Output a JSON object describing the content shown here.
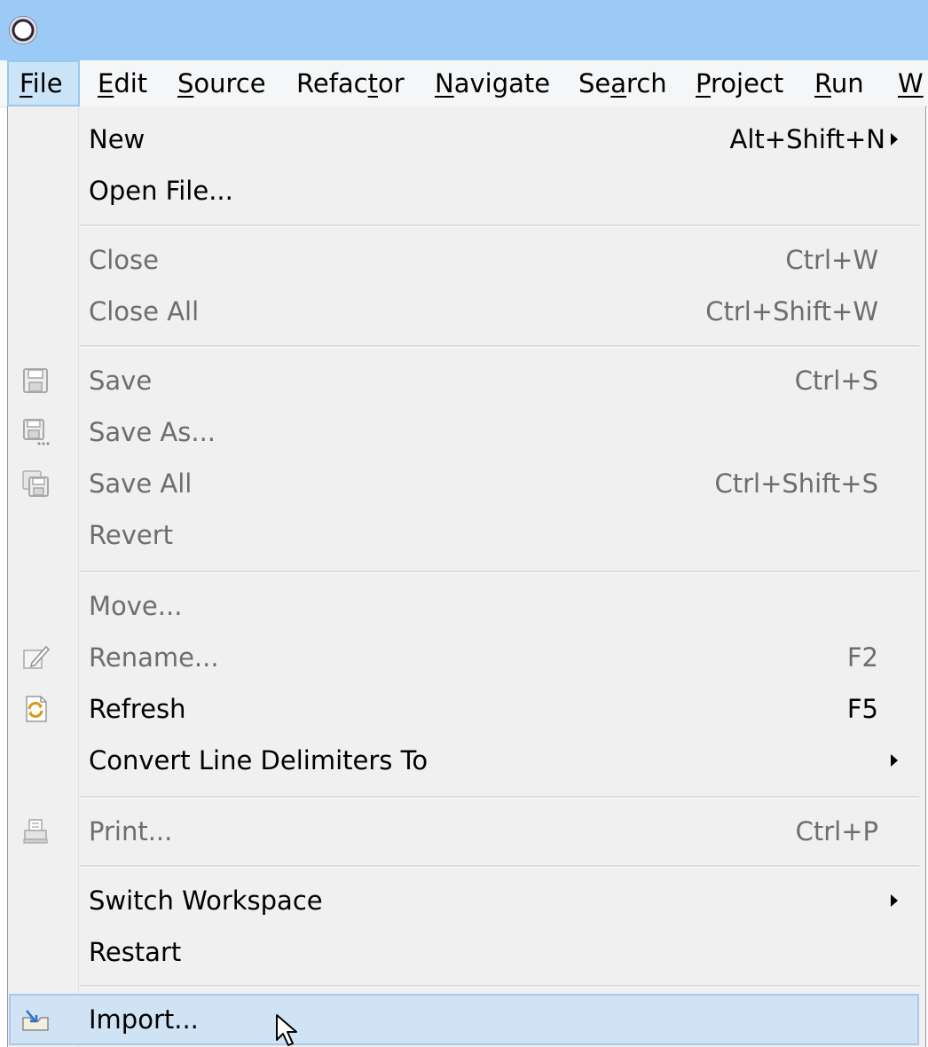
{
  "menubar": {
    "items": [
      {
        "prefix": "",
        "mnemonic": "F",
        "rest": "ile"
      },
      {
        "prefix": "",
        "mnemonic": "E",
        "rest": "dit"
      },
      {
        "prefix": "",
        "mnemonic": "S",
        "rest": "ource"
      },
      {
        "prefix": "Refac",
        "mnemonic": "t",
        "rest": "or"
      },
      {
        "prefix": "",
        "mnemonic": "N",
        "rest": "avigate"
      },
      {
        "prefix": "Se",
        "mnemonic": "a",
        "rest": "rch"
      },
      {
        "prefix": "",
        "mnemonic": "P",
        "rest": "roject"
      },
      {
        "prefix": "",
        "mnemonic": "R",
        "rest": "un"
      },
      {
        "prefix": "",
        "mnemonic": "W",
        "rest": ""
      }
    ]
  },
  "file_menu": {
    "new": {
      "label": "New",
      "shortcut": "Alt+Shift+N"
    },
    "open_file": {
      "label": "Open File..."
    },
    "close": {
      "label": "Close",
      "shortcut": "Ctrl+W"
    },
    "close_all": {
      "label": "Close All",
      "shortcut": "Ctrl+Shift+W"
    },
    "save": {
      "label": "Save",
      "shortcut": "Ctrl+S"
    },
    "save_as": {
      "label": "Save As..."
    },
    "save_all": {
      "label": "Save All",
      "shortcut": "Ctrl+Shift+S"
    },
    "revert": {
      "label": "Revert"
    },
    "move": {
      "label": "Move..."
    },
    "rename": {
      "label": "Rename...",
      "shortcut": "F2"
    },
    "refresh": {
      "label": "Refresh",
      "shortcut": "F5"
    },
    "convert": {
      "label": "Convert Line Delimiters To"
    },
    "print": {
      "label": "Print...",
      "shortcut": "Ctrl+P"
    },
    "switch_workspace": {
      "label": "Switch Workspace"
    },
    "restart": {
      "label": "Restart"
    },
    "import": {
      "label": "Import..."
    }
  },
  "colors": {
    "titlebar": "#9ccaf6",
    "menu_background": "#f0f0f0",
    "highlight": "#d0e3f5",
    "disabled_text": "#6d6d6d"
  }
}
